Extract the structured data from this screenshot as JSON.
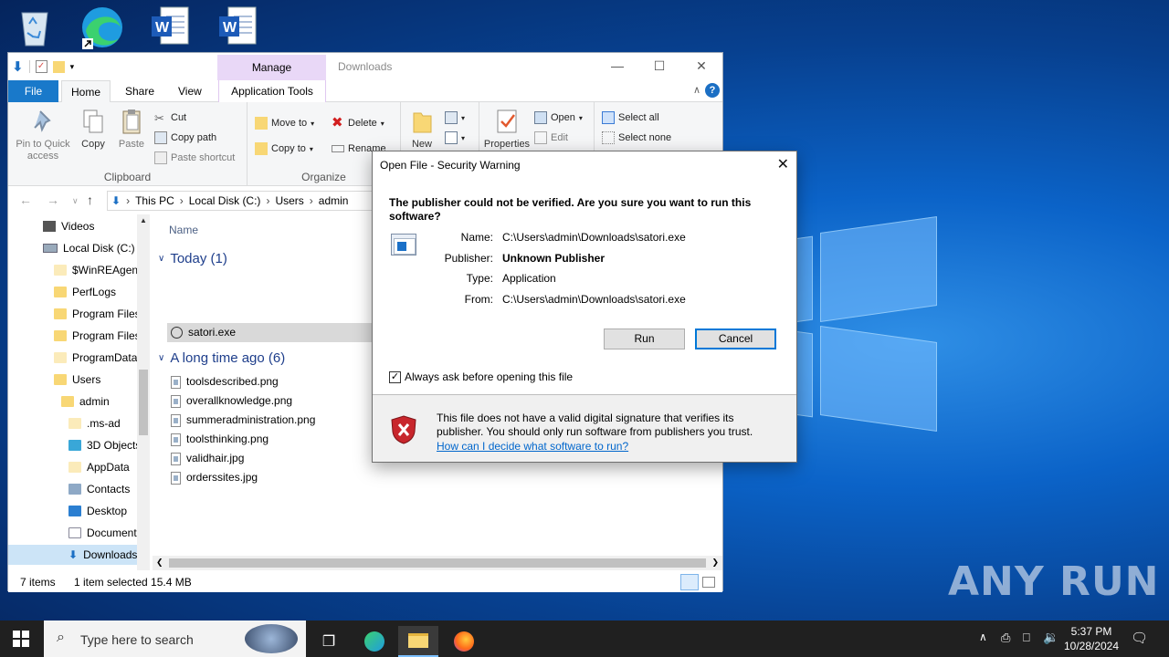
{
  "desktop": {
    "icons": [
      "recycle-bin-icon",
      "edge-icon",
      "word-icon",
      "word-icon"
    ],
    "watermark": "ANY RUN"
  },
  "explorer": {
    "title": "Downloads",
    "manage_tab": "Manage",
    "tabs": {
      "file": "File",
      "home": "Home",
      "share": "Share",
      "view": "View",
      "app_tools": "Application Tools"
    },
    "clipboard": {
      "pin": "Pin to Quick access",
      "copy": "Copy",
      "paste": "Paste",
      "cut": "Cut",
      "copy_path": "Copy path",
      "paste_shortcut": "Paste shortcut",
      "label": "Clipboard"
    },
    "organize": {
      "move_to": "Move to",
      "copy_to": "Copy to",
      "delete": "Delete",
      "rename": "Rename",
      "label": "Organize"
    },
    "new_group": {
      "new": "New"
    },
    "open_group": {
      "properties": "Properties",
      "open": "Open",
      "edit": "Edit"
    },
    "select_group": {
      "select_all": "Select all",
      "select_none": "Select none"
    },
    "address": {
      "this_pc": "This PC",
      "disk": "Local Disk (C:)",
      "users": "Users",
      "admin": "admin"
    },
    "nav": [
      "Videos",
      "Local Disk (C:)",
      "$WinREAgent",
      "PerfLogs",
      "Program Files",
      "Program Files",
      "ProgramData",
      "Users",
      "admin",
      ".ms-ad",
      "3D Objects",
      "AppData",
      "Contacts",
      "Desktop",
      "Documents",
      "Downloads"
    ],
    "column_name": "Name",
    "group_today": "Today (1)",
    "group_old": "A long time ago (6)",
    "files_today": [
      "satori.exe"
    ],
    "files_old": [
      "toolsdescribed.png",
      "overallknowledge.png",
      "summeradministration.png",
      "toolsthinking.png",
      "validhair.jpg",
      "orderssites.jpg"
    ],
    "status": {
      "items": "7 items",
      "selected": "1 item selected  15.4 MB"
    }
  },
  "dialog": {
    "title": "Open File - Security Warning",
    "heading": "The publisher could not be verified.  Are you sure you want to run this software?",
    "labels": {
      "name": "Name:",
      "publisher": "Publisher:",
      "type": "Type:",
      "from": "From:"
    },
    "values": {
      "name": "C:\\Users\\admin\\Downloads\\satori.exe",
      "publisher": "Unknown Publisher",
      "type": "Application",
      "from": "C:\\Users\\admin\\Downloads\\satori.exe"
    },
    "run": "Run",
    "cancel": "Cancel",
    "checkbox": "Always ask before opening this file",
    "checkbox_checked": true,
    "warning": "This file does not have a valid digital signature that verifies its publisher.  You should only run software from publishers you trust.",
    "link": "How can I decide what software to run?"
  },
  "taskbar": {
    "search_placeholder": "Type here to search",
    "time": "5:37 PM",
    "date": "10/28/2024"
  }
}
